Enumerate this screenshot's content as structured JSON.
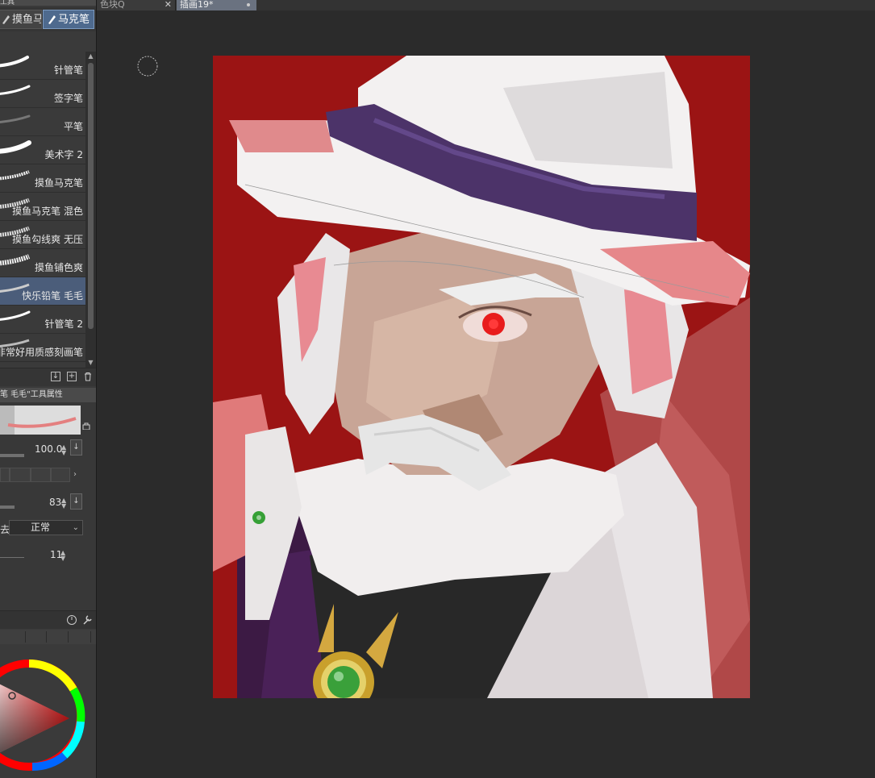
{
  "left_panel": {
    "title": "工具",
    "subtabs": [
      {
        "label": "摸鱼马",
        "active": false
      },
      {
        "label": "马克笔",
        "active": true
      }
    ],
    "brushes": [
      {
        "label": "针管笔"
      },
      {
        "label": "签字笔"
      },
      {
        "label": "平笔"
      },
      {
        "label": "美术字 2"
      },
      {
        "label": "摸鱼马克笔"
      },
      {
        "label": "摸鱼马克笔 混色"
      },
      {
        "label": "摸鱼勾线爽 无压"
      },
      {
        "label": "摸鱼铺色爽"
      },
      {
        "label": "快乐铅笔 毛毛",
        "selected": true
      },
      {
        "label": "针管笔 2"
      },
      {
        "label": "非常好用质感刻画笔"
      }
    ],
    "tool_property": {
      "header": "笔 毛毛\"工具属性",
      "size_value": "100.0",
      "opacity_value": "83",
      "blend_label": "去",
      "blend_mode": "正常",
      "density_value": "11"
    }
  },
  "document_tabs": [
    {
      "label": "色块Q",
      "active": false
    },
    {
      "label": "插画19*",
      "active": true
    }
  ],
  "colors": {
    "canvas_bg": "#9b1414",
    "accent": "#4e6a8e"
  }
}
